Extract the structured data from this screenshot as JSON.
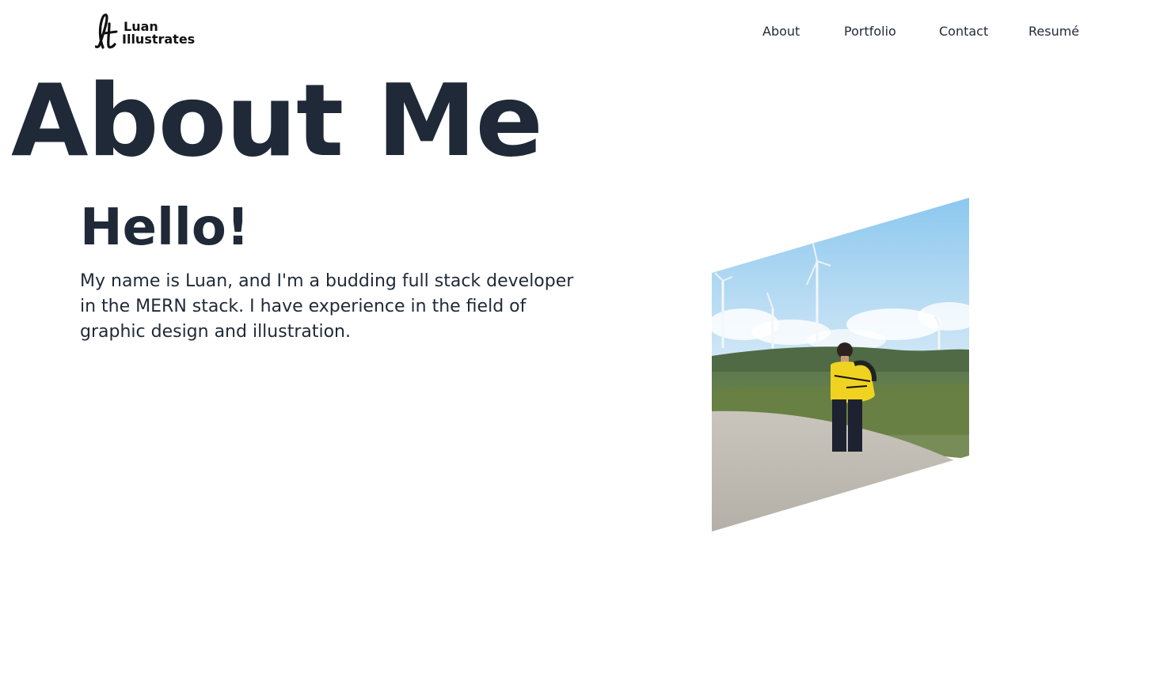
{
  "header": {
    "logo": {
      "line1": "Luan",
      "line2": "Illustrates",
      "mark_letters": "lt"
    },
    "nav": [
      {
        "label": "About"
      },
      {
        "label": "Portfolio"
      },
      {
        "label": "Contact"
      },
      {
        "label": "Resumé"
      }
    ]
  },
  "main": {
    "page_title": "About Me",
    "greeting": "Hello!",
    "bio": "My name is Luan, and I'm a budding full stack developer in the MERN stack. I have experience in the field of graphic design and illustration."
  },
  "colors": {
    "heading": "#1f2937",
    "nav_text": "#111111",
    "background": "#ffffff"
  }
}
